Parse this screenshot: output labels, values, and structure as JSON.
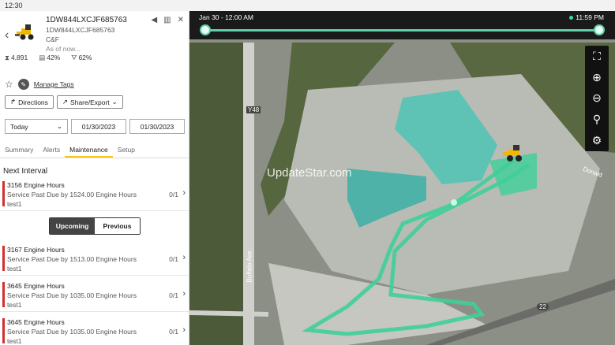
{
  "status": {
    "time": "12:30"
  },
  "asset": {
    "title": "1DW844LXCJF685763",
    "subtitle": "1DW844LXCJF685763",
    "group": "C&F",
    "as_of": "As of now...",
    "metrics": [
      {
        "icon": "hours-icon",
        "value": "4,891"
      },
      {
        "icon": "fuel-icon",
        "value": "42%"
      },
      {
        "icon": "def-icon",
        "value": "62%"
      }
    ],
    "manage_tags": "Manage Tags"
  },
  "actions": {
    "directions": "Directions",
    "share": "Share/Export"
  },
  "filters": {
    "range": "Today",
    "start": "01/30/2023",
    "end": "01/30/2023"
  },
  "tabs": [
    "Summary",
    "Alerts",
    "Maintenance",
    "Setup"
  ],
  "active_tab": "Maintenance",
  "next_interval": {
    "title": "Next Interval",
    "item": {
      "hours": "3156 Engine Hours",
      "status": "Service Past Due by 1524.00 Engine Hours",
      "note": "test1",
      "count": "0/1"
    }
  },
  "toggle": {
    "upcoming": "Upcoming",
    "previous": "Previous"
  },
  "upcoming": [
    {
      "hours": "3167 Engine Hours",
      "status": "Service Past Due by 1513.00 Engine Hours",
      "note": "test1",
      "count": "0/1"
    },
    {
      "hours": "3645 Engine Hours",
      "status": "Service Past Due by 1035.00 Engine Hours",
      "note": "test1",
      "count": "0/1"
    },
    {
      "hours": "3645 Engine Hours",
      "status": "Service Past Due by 1035.00 Engine Hours",
      "note": "test1",
      "count": "0/1"
    }
  ],
  "timeline": {
    "start": "Jan 30 - 12:00 AM",
    "end": "11:59 PM"
  },
  "map": {
    "watermark": "UpdateStar.com",
    "road_labels": [
      "Y48",
      "Buffalo Ave",
      "Donald",
      "22"
    ],
    "controls": [
      "fullscreen-icon",
      "zoom-in-icon",
      "zoom-out-icon",
      "locate-asset-icon",
      "settings-icon"
    ]
  }
}
